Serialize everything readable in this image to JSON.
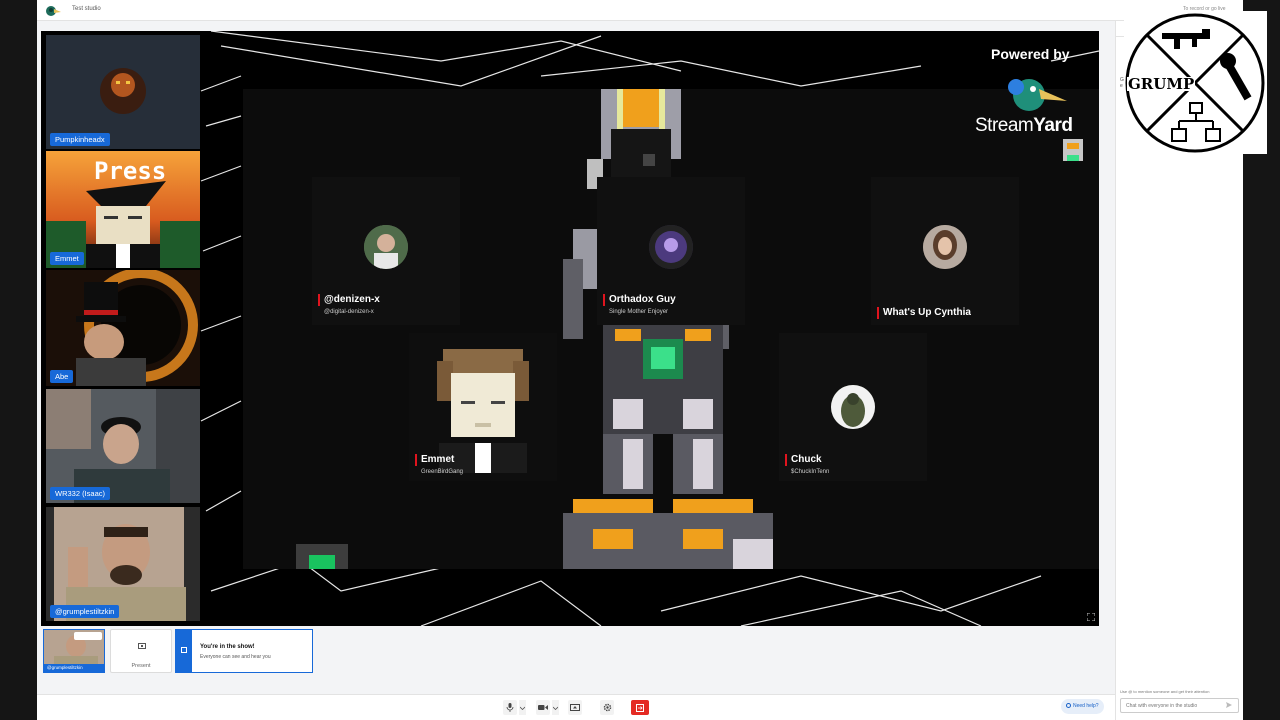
{
  "app": {
    "title": "Test studio",
    "record_hint": "To record or go live"
  },
  "brand": {
    "powered_by": "Powered by",
    "stream": "Stream",
    "yard": "Yard"
  },
  "overlay": {
    "text": "GRUMP"
  },
  "cameras": [
    {
      "name": "Pumpkinheadx"
    },
    {
      "name": "Emmet",
      "art_text": "Press"
    },
    {
      "name": "Abe"
    },
    {
      "name": "WR332 (Isaac)"
    },
    {
      "name": "@grumplestiltzkin"
    }
  ],
  "participants": [
    {
      "name": "@denizen-x",
      "sub": "@digital-denizen-x"
    },
    {
      "name": "Orthadox Guy",
      "sub": "Single Mother Enjoyer"
    },
    {
      "name": "What's Up Cynthia",
      "sub": ""
    },
    {
      "name": "Emmet",
      "sub": "GreenBirdGang"
    },
    {
      "name": "Chuck",
      "sub": "$ChuckInTenn"
    }
  ],
  "strip": {
    "self_label": "@grumplestiltzkin",
    "present_label": "Present",
    "banner_title": "You're in the show!",
    "banner_sub": "Everyone can see and hear you"
  },
  "controls": {
    "help": "Need help?"
  },
  "chat": {
    "fragment": "Gr\ne",
    "hint": "Use @ to mention someone and get their attention",
    "placeholder": "Chat with everyone in the studio"
  },
  "colors": {
    "accent": "#1769d8",
    "live_red": "#e42a24",
    "tag_red": "#e0141e"
  }
}
